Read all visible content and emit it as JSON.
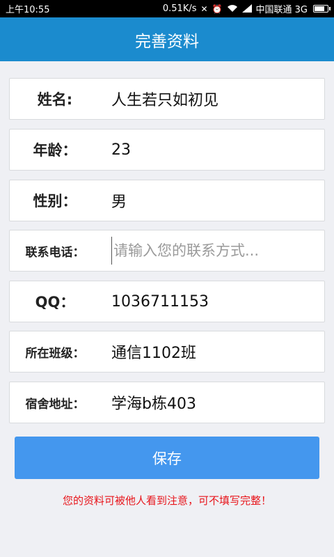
{
  "status_bar": {
    "time": "上午10:55",
    "speed": "0.51K/s",
    "carrier": "中国联通 3G",
    "icons": [
      "mute-icon",
      "alarm-icon",
      "wifi-icon",
      "signal-icon",
      "battery-icon"
    ]
  },
  "header": {
    "title": "完善资料"
  },
  "form": {
    "name_label": "姓名:",
    "name_value": "人生若只如初见",
    "age_label": "年龄：",
    "age_value": "23",
    "gender_label": "性别：",
    "gender_value": "男",
    "phone_label": "联系电话：",
    "phone_placeholder": "请输入您的联系方式...",
    "qq_label": "QQ：",
    "qq_value": "1036711153",
    "class_label": "所在班级：",
    "class_value": "通信1102班",
    "dorm_label": "宿舍地址：",
    "dorm_value": "学海b栋403"
  },
  "save_label": "保存",
  "notice": "您的资料可被他人看到注意，可不填写完整！",
  "colors": {
    "header": "#1b8bce",
    "button": "#4497ee",
    "notice": "#e8151b"
  }
}
